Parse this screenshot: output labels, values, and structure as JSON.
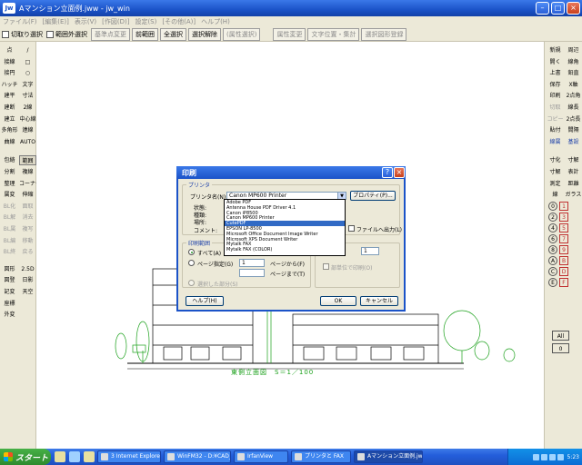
{
  "window": {
    "app_icon": "Jw",
    "title": "Aマンション立面例.jww - jw_win"
  },
  "menu": [
    "ファイル(F)",
    "[編集(E)]",
    "表示(V)",
    "[作図(D)]",
    "設定(S)",
    "[その他(A)]",
    "ヘルプ(H)"
  ],
  "toolbar": {
    "checkbox1": "切取り選択",
    "checkbox2": "範囲外選択",
    "buttons": [
      "基準点変更",
      "前範囲",
      "全選択",
      "選択解除",
      "(属性選択)",
      "属性変更",
      "文字位置・集計",
      "選択図形登録"
    ]
  },
  "left_palette": [
    [
      "点",
      "/"
    ],
    [
      "接線",
      "□"
    ],
    [
      "接円",
      "○"
    ],
    [
      "ハッチ",
      "文字"
    ],
    [
      "建平",
      "寸法"
    ],
    [
      "建断",
      "2線"
    ],
    [
      "建立",
      "中心線"
    ],
    [
      "多角形",
      "連線"
    ],
    [
      "曲線",
      "AUTO"
    ],
    [
      "包絡",
      "範囲"
    ],
    [
      "分割",
      "複線"
    ],
    [
      "整理",
      "コーナー"
    ],
    [
      "属変",
      "伸縮"
    ],
    [
      "BL化",
      "面取"
    ],
    [
      "BL解",
      "消去"
    ],
    [
      "BL属",
      "複写"
    ],
    [
      "BL編",
      "移動"
    ],
    [
      "BL終",
      "戻る"
    ],
    [
      "図形",
      "2.5D"
    ],
    [
      "図登",
      "日影"
    ],
    [
      "記変",
      "天空"
    ],
    [
      "座標",
      ""
    ],
    [
      "外変",
      ""
    ]
  ],
  "right_palette": [
    [
      "新規",
      "周辺"
    ],
    [
      "開く",
      "線角"
    ],
    [
      "上書",
      "鉛直"
    ],
    [
      "保存",
      "X軸"
    ],
    [
      "印刷",
      "2点角"
    ],
    [
      "切取",
      "線長"
    ],
    [
      "コピー",
      "2点長"
    ],
    [
      "貼付",
      "間隔"
    ],
    [
      "線属",
      "基設"
    ],
    [
      "寸化",
      "寸解"
    ],
    [
      "寸解",
      "表計"
    ],
    [
      "測定",
      "距離"
    ],
    [
      "線",
      "ガラス"
    ]
  ],
  "right_layers": [
    "0",
    "1",
    "2",
    "3",
    "4",
    "5",
    "6",
    "7",
    "8",
    "9",
    "A",
    "B",
    "C",
    "D",
    "E",
    "F"
  ],
  "drawing": {
    "caption": "東側立面図　S＝1／100"
  },
  "print_dialog": {
    "title": "印刷",
    "printer_group": "プリンタ",
    "printer_name_label": "プリンタ名(N):",
    "printer_name_value": "Canon MP600 Printer",
    "properties_button": "プロパティ(P)...",
    "status_label": "状態:",
    "type_label": "種類:",
    "where_label": "場所:",
    "comment_label": "コメント:",
    "print_to_file": "ファイルへ出力(L)",
    "range_group": "印刷範囲",
    "range_all": "すべて(A)",
    "range_pages": "ページ指定(G)",
    "page_from_value": "1",
    "page_from_label": "ページから(F)",
    "page_to_label": "ページまで(T)",
    "range_selection": "選択した部分(S)",
    "copies_value": "1",
    "collate": "部単位で印刷(O)",
    "help_button": "ヘルプ(H)",
    "ok_button": "OK",
    "cancel_button": "キャンセル",
    "printer_options": [
      "Adobe PDF",
      "Antenna House PDF Driver 4.1",
      "Canon iP8500",
      "Canon MP600 Printer",
      "CutePDF",
      "EPSON LP-8500",
      "Microsoft Office Document Image Writer",
      "Microsoft XPS Document Writer",
      "Mytalk FAX",
      "Mytalk FAX (COLOR)"
    ],
    "selected_option_index": 4
  },
  "taskbar": {
    "start": "スタート",
    "tasks": [
      "3 Internet Explorer",
      "WinFM32 - D:¥CAD_...",
      "IrfanView",
      "プリンタと FAX",
      "Aマンション立面例.jww..."
    ],
    "clock": "5:23"
  }
}
